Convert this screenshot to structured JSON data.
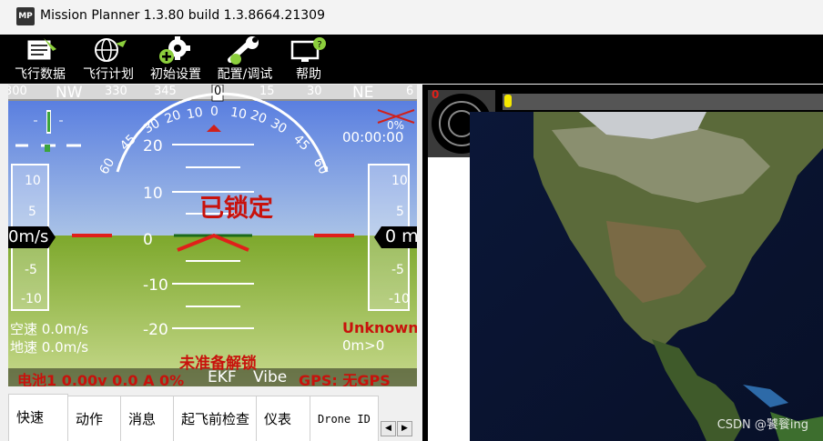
{
  "window": {
    "title": "Mission Planner 1.3.80 build 1.3.8664.21309",
    "logo_text": "MP"
  },
  "menu": [
    {
      "label": "飞行数据",
      "icon": "flight-data-icon"
    },
    {
      "label": "飞行计划",
      "icon": "globe-icon"
    },
    {
      "label": "初始设置",
      "icon": "gear-add-icon"
    },
    {
      "label": "配置/调试",
      "icon": "wrench-icon"
    },
    {
      "label": "帮助",
      "icon": "monitor-help-icon"
    }
  ],
  "hud": {
    "heading_ticks": [
      "300",
      "NW",
      "330",
      "345",
      "0",
      "15",
      "30",
      "NE",
      "6"
    ],
    "heading_value": "0",
    "roll_labels": [
      "60",
      "45",
      "30",
      "20",
      "10",
      "0",
      "10",
      "20",
      "30",
      "45",
      "60"
    ],
    "pitch_labels": [
      "20",
      "10",
      "0",
      "-10",
      "-20"
    ],
    "speed_ticks": [
      "10",
      "5",
      "-5",
      "-10"
    ],
    "alt_ticks": [
      "10",
      "5",
      "-5",
      "-10"
    ],
    "speed_value": "0m/s",
    "alt_value": "0 m",
    "lock_status": "已锁定",
    "timer": "00:00:00",
    "battery_pct": "0%",
    "airspeed": "空速 0.0m/s",
    "groundspeed": "地速 0.0m/s",
    "mode": "Unknown",
    "wp_dist": "0m>0",
    "arm_status": "未准备解锁",
    "battery": "电池1 0.00v 0.0 A 0%",
    "ekf": "EKF",
    "vibe": "Vibe",
    "gps": "GPS: 无GPS",
    "colors": {
      "sky": "#6f8fd6",
      "ground": "#8db43a",
      "alert": "#c8120c"
    }
  },
  "tabs": [
    {
      "label": "快速",
      "active": true
    },
    {
      "label": "动作"
    },
    {
      "label": "消息"
    },
    {
      "label": "起飞前检查"
    },
    {
      "label": "仪表"
    },
    {
      "label": "Drone ID"
    }
  ],
  "map_panel": {
    "counter": "0"
  },
  "watermark": "CSDN @饕餮ing"
}
